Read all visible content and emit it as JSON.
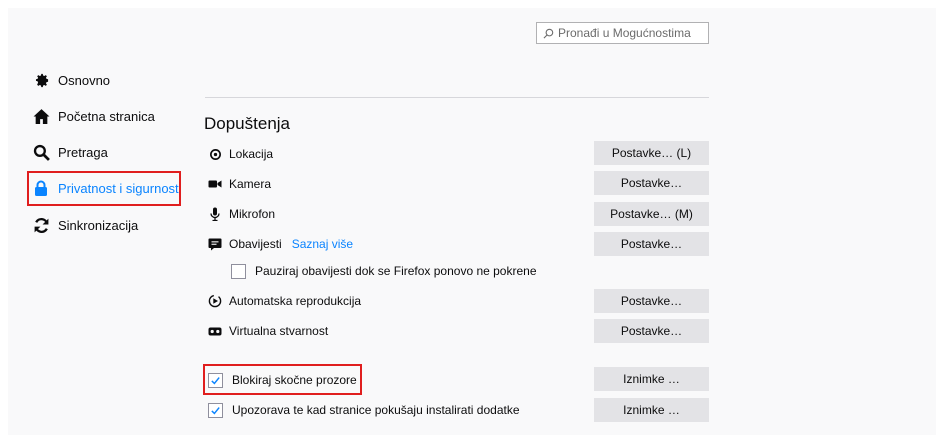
{
  "search": {
    "placeholder": "Pronađi u Mogućnostima"
  },
  "sidebar": {
    "items": [
      {
        "label": "Osnovno",
        "icon": "gear-icon"
      },
      {
        "label": "Početna stranica",
        "icon": "home-icon"
      },
      {
        "label": "Pretraga",
        "icon": "search-icon"
      },
      {
        "label": "Privatnost i sigurnost",
        "icon": "lock-icon",
        "active": true
      },
      {
        "label": "Sinkronizacija",
        "icon": "sync-icon"
      }
    ]
  },
  "permissions": {
    "title": "Dopuštenja",
    "rows": [
      {
        "label": "Lokacija",
        "icon": "location-icon",
        "button": "Postavke… (L)"
      },
      {
        "label": "Kamera",
        "icon": "camera-icon",
        "button": "Postavke…"
      },
      {
        "label": "Mikrofon",
        "icon": "microphone-icon",
        "button": "Postavke… (M)"
      },
      {
        "label": "Obavijesti",
        "icon": "notification-icon",
        "link": "Saznaj više",
        "button": "Postavke…"
      },
      {
        "label": "Automatska reprodukcija",
        "icon": "autoplay-icon",
        "button": "Postavke…"
      },
      {
        "label": "Virtualna stvarnost",
        "icon": "vr-icon",
        "button": "Postavke…"
      }
    ],
    "pause_notifications": {
      "label": "Pauziraj obavijesti dok se Firefox ponovo ne pokrene",
      "checked": false
    },
    "block_popups": {
      "label": "Blokiraj skočne prozore",
      "checked": true,
      "button": "Iznimke …"
    },
    "warn_addons": {
      "label": "Upozorava te kad stranice pokušaju instalirati dodatke",
      "checked": true,
      "button": "Iznimke …"
    }
  },
  "colors": {
    "accent": "#0a84ff",
    "highlight": "#e01e1e",
    "background": "#f9f9fa",
    "button": "#e3e3e6"
  }
}
